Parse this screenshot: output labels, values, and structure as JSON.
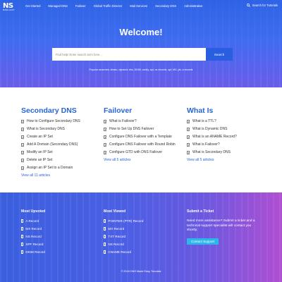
{
  "logo": {
    "mark": "NS",
    "sub": "MADE EASY"
  },
  "nav": {
    "items": [
      "Get Started",
      "Managed DNS",
      "Failover",
      "Global Traffic Director",
      "Mail Services",
      "Secondary DNS",
      "Administrative"
    ],
    "search_label": "Search for Tutorials"
  },
  "hero": {
    "title": "Welcome!",
    "search_placeholder": "Find help! Enter search term here...",
    "search_button": "Search",
    "popular": "Popular searches: dmarc, dynamic dns, DKIM, zonify, api, ns records, spf, MX, ptr, a records"
  },
  "columns": [
    {
      "title": "Secondary DNS",
      "items": [
        "How to Configure Secondary DNS",
        "What is Secondary DNS",
        "Create an IP Set",
        "Add A Domain (Secondary DNS)",
        "Modify an IP Set",
        "Delete an IP Set",
        "Assign an IP Set to a Domain"
      ],
      "view_all": "View all 11 articles"
    },
    {
      "title": "Failover",
      "items": [
        "What is Failover?",
        "How to Set Up DNS Failover",
        "Configure DNS Failover with a Template",
        "Configure DNS Failover with Round Robin",
        "Configure GTD with DNS Failover"
      ],
      "view_all": "View all 5 articles"
    },
    {
      "title": "What Is",
      "items": [
        "What is a TTL?",
        "What is Dynamic DNS",
        "What is an ANAME Record?",
        "What is Failover?",
        "What is Secondary DNS"
      ],
      "view_all": "View all 5 articles"
    }
  ],
  "footer": {
    "most_upvoted": {
      "title": "Most Upvoted",
      "items": [
        "A Record",
        "MX Record",
        "NS Record",
        "SPF Record",
        "DKIM Record"
      ]
    },
    "most_viewed": {
      "title": "Most Viewed",
      "items": [
        "POINTER (PTR) Record",
        "MX Record",
        "TXT Record",
        "NS Record",
        "CNAME Record"
      ]
    },
    "ticket": {
      "title": "Submit a Ticket",
      "text": "Need more assistance? Submit a ticket and a technical support specialist will contact you shortly.",
      "button": "Contact Support"
    },
    "copyright": "© 2018 DNS Made Easy Tutorials"
  },
  "colors": {
    "hero_top": "#2e63e6",
    "heading_blue": "#2766d6",
    "search_button": "#2a5ee0",
    "support_button": "#2bb7e8",
    "footer_end": "#b04fd2"
  }
}
